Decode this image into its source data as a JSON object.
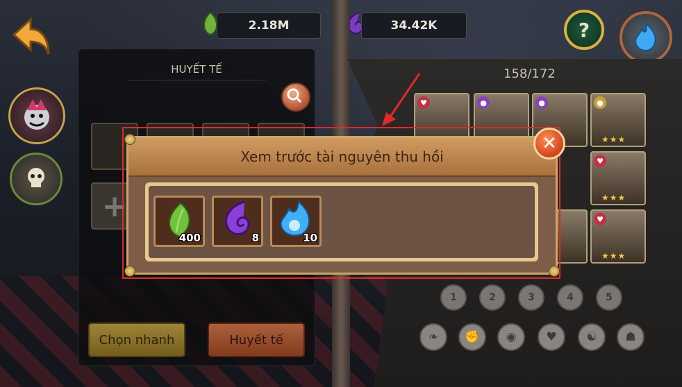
{
  "topbar": {
    "green_amount": "2.18M",
    "purple_amount": "34.42K",
    "green_icon": "green-leaf-icon",
    "purple_icon": "purple-swirl-icon",
    "help_icon": "question-mark-icon",
    "help_label": "?",
    "back_icon": "back-arrow-icon",
    "avatar_icon": "blue-flame-icon"
  },
  "left_panel": {
    "title": "HUYẾT TẾ",
    "search_icon": "magnifier-icon",
    "add_slot_label": "+",
    "quick_select_label": "Chọn nhanh",
    "sacrifice_label": "Huyết tế"
  },
  "roster": {
    "counter": "158/172"
  },
  "filters": {
    "stars": [
      "1",
      "2",
      "3",
      "4",
      "5"
    ],
    "types": [
      "wing-icon",
      "fist-icon",
      "eye-icon",
      "heart-icon",
      "brain-icon",
      "hood-icon"
    ]
  },
  "modal": {
    "title": "Xem trước tài nguyên thu hồi",
    "close_label": "✕",
    "items": [
      {
        "icon": "green-leaf-icon",
        "qty": "400"
      },
      {
        "icon": "purple-swirl-icon",
        "qty": "8"
      },
      {
        "icon": "blue-flame-icon",
        "qty": "10"
      }
    ]
  },
  "colors": {
    "annotation_frame": "#e02a2a",
    "modal_header": "#b98048",
    "modal_body": "#6c5344"
  }
}
